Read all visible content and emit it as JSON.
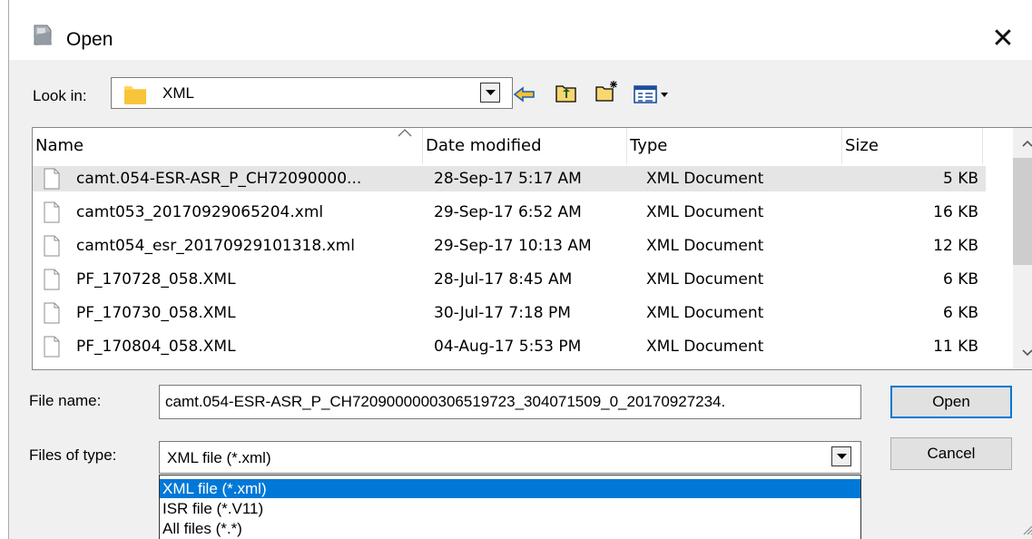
{
  "window": {
    "title": "Open",
    "close_glyph": "✕"
  },
  "look_in": {
    "label": "Look in:",
    "value": "XML",
    "icons": [
      "folder-icon",
      "back-arrow-icon",
      "up-folder-icon",
      "new-folder-icon",
      "view-menu-icon"
    ]
  },
  "columns": [
    "Name",
    "Date modified",
    "Type",
    "Size"
  ],
  "files": [
    {
      "name": "camt.054-ESR-ASR_P_CH72090000...",
      "date": "28-Sep-17 5:17 AM",
      "type": "XML Document",
      "size": "5 KB",
      "selected": true
    },
    {
      "name": "camt053_20170929065204.xml",
      "date": "29-Sep-17 6:52 AM",
      "type": "XML Document",
      "size": "16 KB",
      "selected": false
    },
    {
      "name": "camt054_esr_20170929101318.xml",
      "date": "29-Sep-17 10:13 AM",
      "type": "XML Document",
      "size": "12 KB",
      "selected": false
    },
    {
      "name": "PF_170728_058.XML",
      "date": "28-Jul-17 8:45 AM",
      "type": "XML Document",
      "size": "6 KB",
      "selected": false
    },
    {
      "name": "PF_170730_058.XML",
      "date": "30-Jul-17 7:18 PM",
      "type": "XML Document",
      "size": "6 KB",
      "selected": false
    },
    {
      "name": "PF_170804_058.XML",
      "date": "04-Aug-17 5:53 PM",
      "type": "XML Document",
      "size": "11 KB",
      "selected": false
    }
  ],
  "file_name": {
    "label": "File name:",
    "value": "camt.054-ESR-ASR_P_CH7209000000306519723_304071509_0_20170927234."
  },
  "files_of_type": {
    "label": "Files of type:",
    "value": "XML file (*.xml)",
    "options": [
      "XML file (*.xml)",
      "ISR file (*.V11)",
      "All files (*.*)"
    ],
    "highlighted_index": 0
  },
  "buttons": {
    "open": "Open",
    "cancel": "Cancel"
  },
  "colors": {
    "selection_blue": "#0078d7",
    "row_selected": "#e5e5e5",
    "dialog_bg": "#f0f0f0"
  }
}
